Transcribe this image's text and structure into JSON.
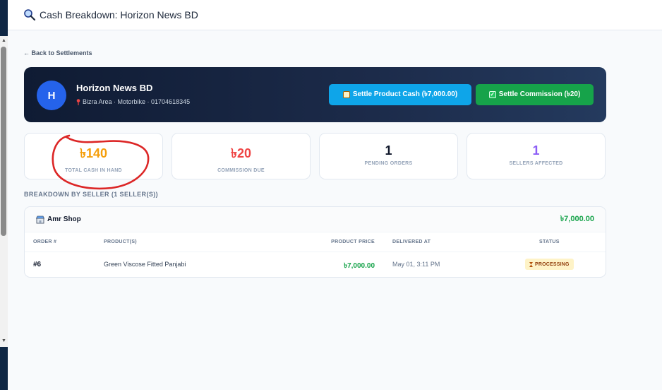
{
  "header": {
    "title": "Cash Breakdown: Horizon News BD",
    "icon": "search-icon"
  },
  "back_link": "← Back to Settlements",
  "profile": {
    "initial": "H",
    "name": "Horizon News BD",
    "meta": "Bizra Area · Motorbike · 01704618345",
    "settle_product_label": "Settle Product Cash (৳7,000.00)",
    "settle_commission_label": "Settle Commission (৳20)",
    "colors": {
      "product_button": "#0ea5e9",
      "commission_button": "#16a34a",
      "avatar": "#2563eb"
    }
  },
  "stats": [
    {
      "value": "৳140",
      "label": "TOTAL CASH IN HAND",
      "color": "#f59e0b"
    },
    {
      "value": "৳20",
      "label": "COMMISSION DUE",
      "color": "#ef4444"
    },
    {
      "value": "1",
      "label": "PENDING ORDERS",
      "color": "#0f172a"
    },
    {
      "value": "1",
      "label": "SELLERS AFFECTED",
      "color": "#8b5cf6"
    }
  ],
  "section_title": "BREAKDOWN BY SELLER (1 SELLER(S))",
  "seller": {
    "name": "Amr Shop",
    "total": "৳7,000.00",
    "columns": [
      "ORDER #",
      "PRODUCT(S)",
      "PRODUCT PRICE",
      "DELIVERED AT",
      "STATUS"
    ],
    "rows": [
      {
        "order": "#6",
        "product": "Green Viscose Fitted Panjabi",
        "price": "৳7,000.00",
        "delivered": "May 01, 3:11 PM",
        "status": "PROCESSING"
      }
    ]
  }
}
